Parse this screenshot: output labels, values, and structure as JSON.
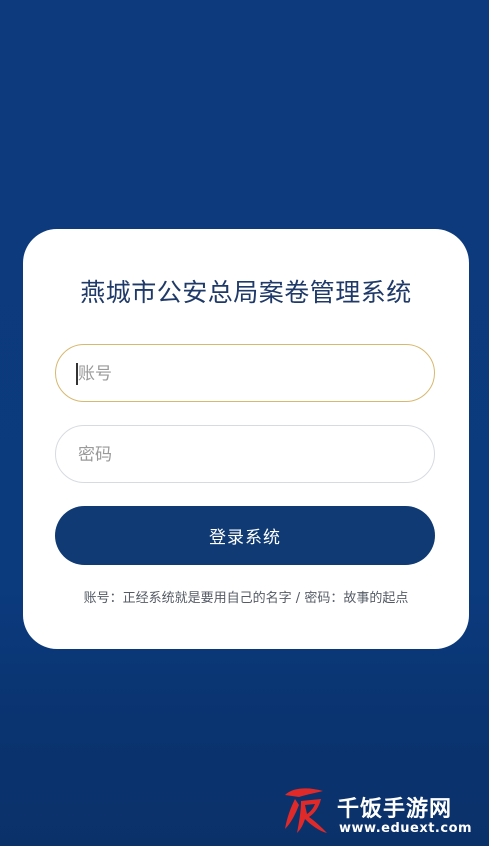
{
  "login": {
    "title": "燕城市公安总局案卷管理系统",
    "username_placeholder": "账号",
    "password_placeholder": "密码",
    "submit_label": "登录系统",
    "hint": "账号：正经系统就是要用自己的名字 / 密码：故事的起点"
  },
  "watermark": {
    "name": "千饭手游网",
    "url": "www.eduext.com"
  },
  "colors": {
    "background": "#0c3a7c",
    "button": "#0f3a74",
    "focus_border": "#d8b86f",
    "title": "#1f3a68",
    "watermark_red": "#e02a2a"
  },
  "icons": {
    "watermark_logo": "red-brush-character-logo"
  }
}
